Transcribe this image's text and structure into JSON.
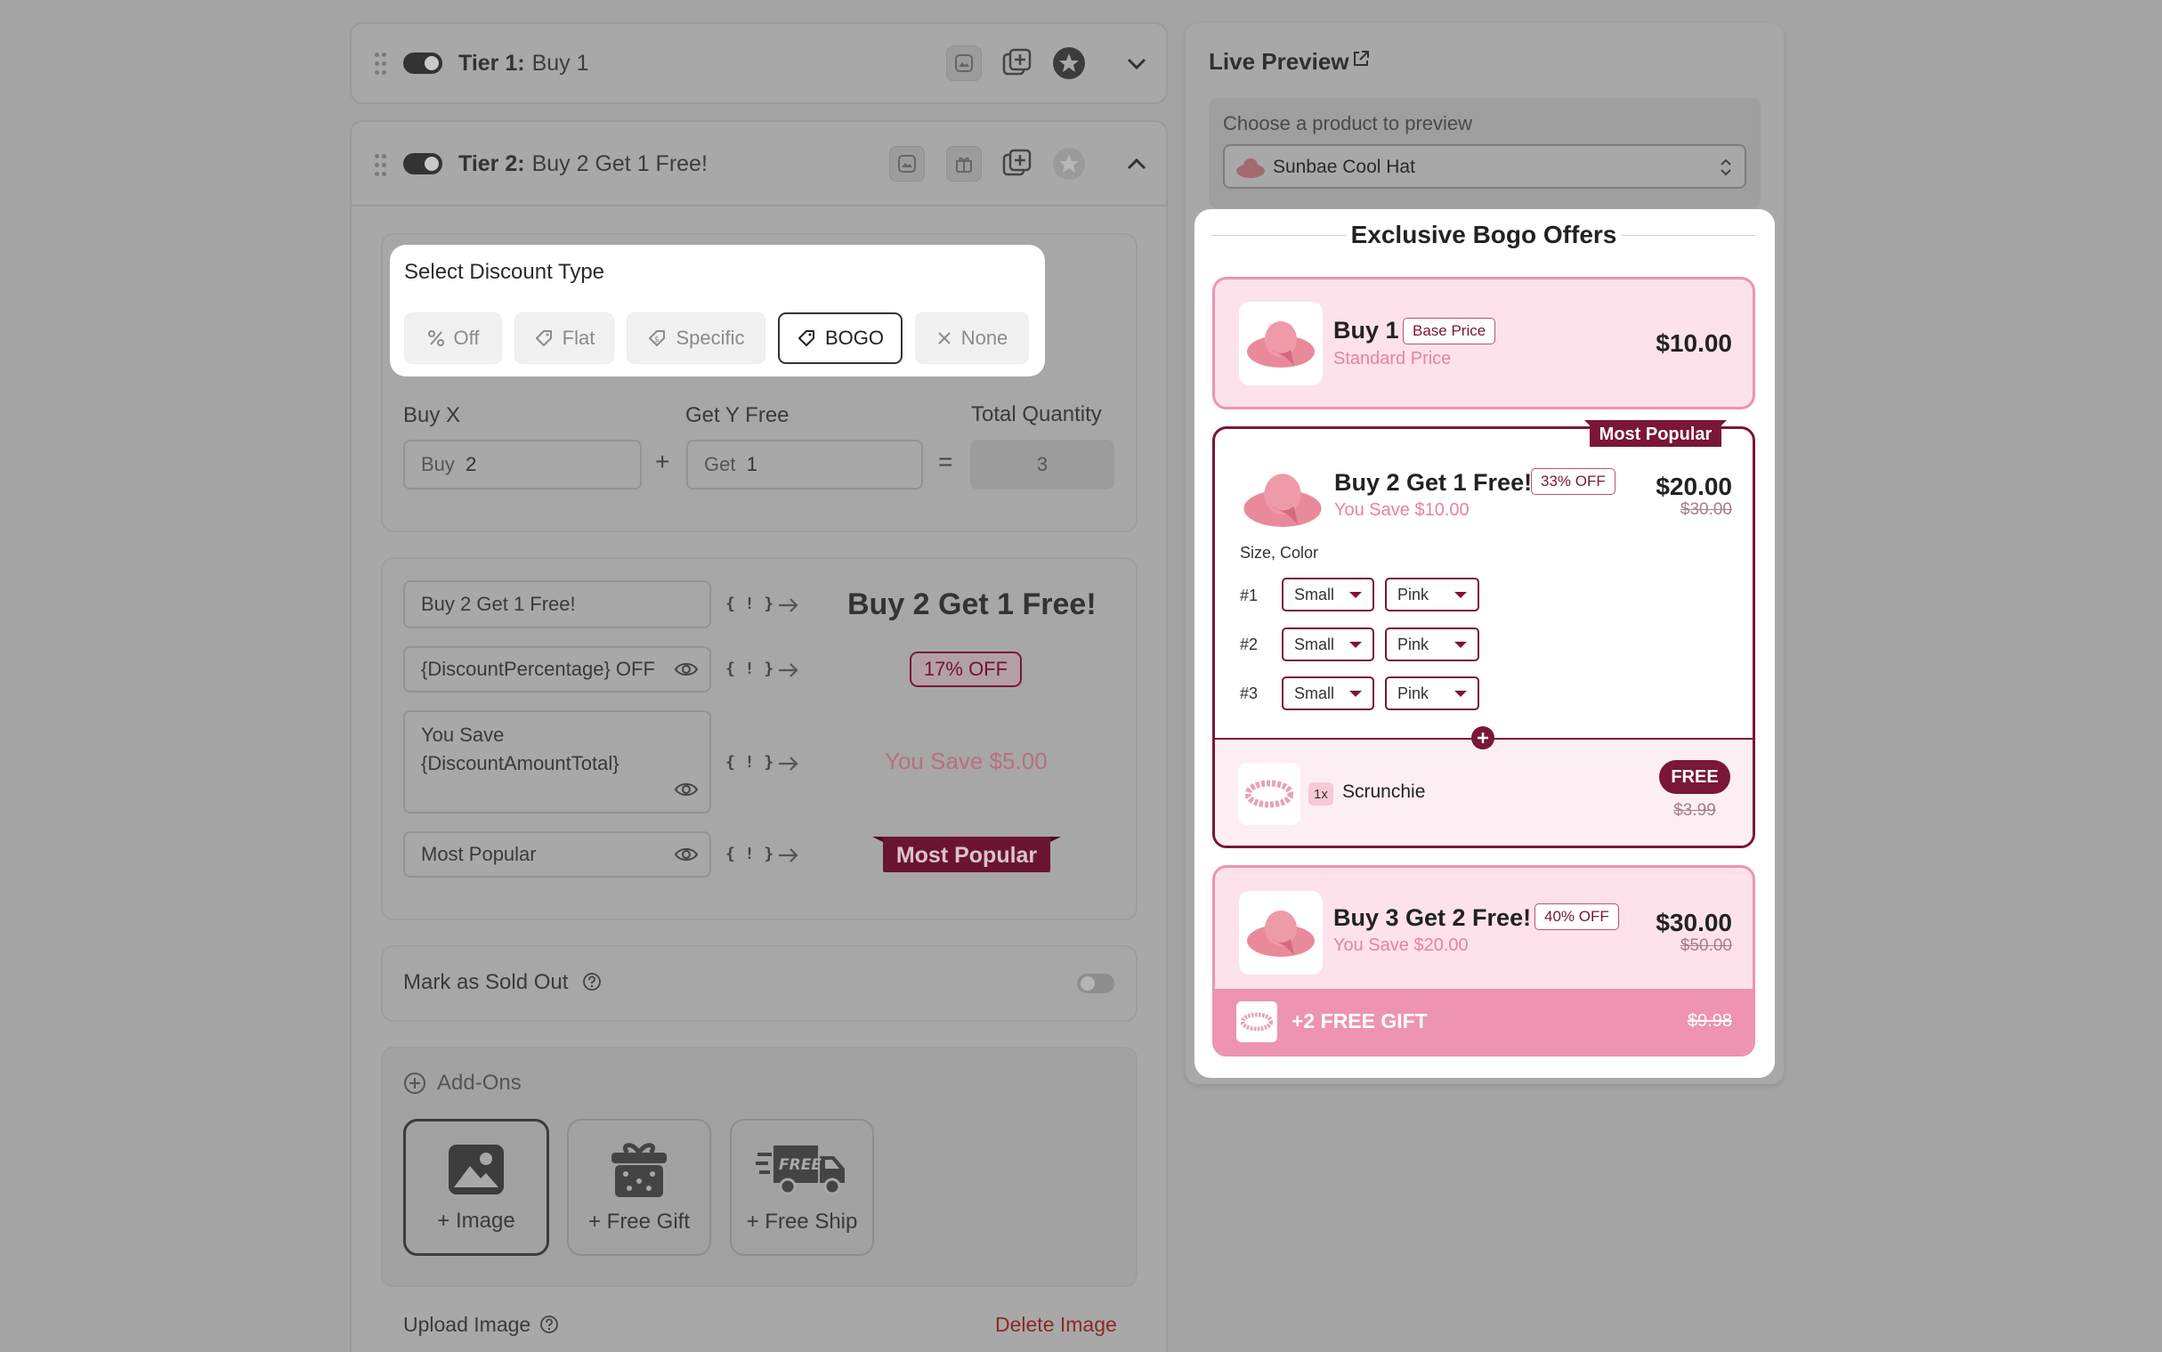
{
  "tiers": [
    {
      "label": "Tier 1:",
      "name": "Buy 1"
    },
    {
      "label": "Tier 2:",
      "name": "Buy 2 Get 1 Free!"
    }
  ],
  "discount_type": {
    "title": "Select Discount Type",
    "options": [
      "Off",
      "Flat",
      "Specific",
      "BOGO",
      "None"
    ],
    "selected": "BOGO"
  },
  "quantity": {
    "buy_label": "Buy X",
    "get_label": "Get Y Free",
    "total_label": "Total Quantity",
    "buy_prefix": "Buy",
    "buy_value": "2",
    "get_prefix": "Get",
    "get_value": "1",
    "plus": "+",
    "equals": "=",
    "total_value": "3"
  },
  "text_rows": {
    "curly": "{ ! }",
    "title_input": "Buy 2 Get 1 Free!",
    "title_preview": "Buy 2 Get 1 Free!",
    "badge_input": "{DiscountPercentage} OFF",
    "badge_preview": "17% OFF",
    "save_input_line1": "You Save",
    "save_input_line2": "{DiscountAmountTotal}",
    "save_preview": "You Save $5.00",
    "label_input": "Most Popular",
    "label_preview": "Most Popular"
  },
  "sold_out": {
    "label": "Mark as Sold Out"
  },
  "addons": {
    "title": "Add-Ons",
    "image": "+ Image",
    "gift": "+ Free Gift",
    "ship": "+ Free Ship",
    "ship_icon_text": "FREE"
  },
  "upload": {
    "label": "Upload Image",
    "delete": "Delete Image"
  },
  "preview": {
    "title": "Live Preview",
    "choose_label": "Choose a product to preview",
    "product": "Sunbae Cool Hat",
    "heading": "Exclusive Bogo Offers",
    "offers": [
      {
        "title": "Buy 1",
        "badge": "Base Price",
        "subtitle": "Standard Price",
        "price": "$10.00"
      },
      {
        "title": "Buy 2 Get 1 Free!",
        "badge": "33% OFF",
        "subtitle": "You Save $10.00",
        "price": "$20.00",
        "compare": "$30.00",
        "ribbon": "Most Popular",
        "variant_label": "Size, Color",
        "variants": [
          {
            "n": "#1",
            "size": "Small",
            "color": "Pink"
          },
          {
            "n": "#2",
            "size": "Small",
            "color": "Pink"
          },
          {
            "n": "#3",
            "size": "Small",
            "color": "Pink"
          }
        ],
        "gift_qty": "1x",
        "gift_name": "Scrunchie",
        "gift_badge": "FREE",
        "gift_compare": "$3.99"
      },
      {
        "title": "Buy 3 Get 2 Free!",
        "badge": "40% OFF",
        "subtitle": "You Save $20.00",
        "price": "$30.00",
        "compare": "$50.00",
        "gift_banner": "+2 FREE GIFT",
        "gift_banner_compare": "$9.98"
      }
    ]
  },
  "colors": {
    "accent": "#7a1638",
    "pink": "#fde2ec",
    "pink_border": "#ee93b1",
    "pink_text": "#e8829f"
  }
}
